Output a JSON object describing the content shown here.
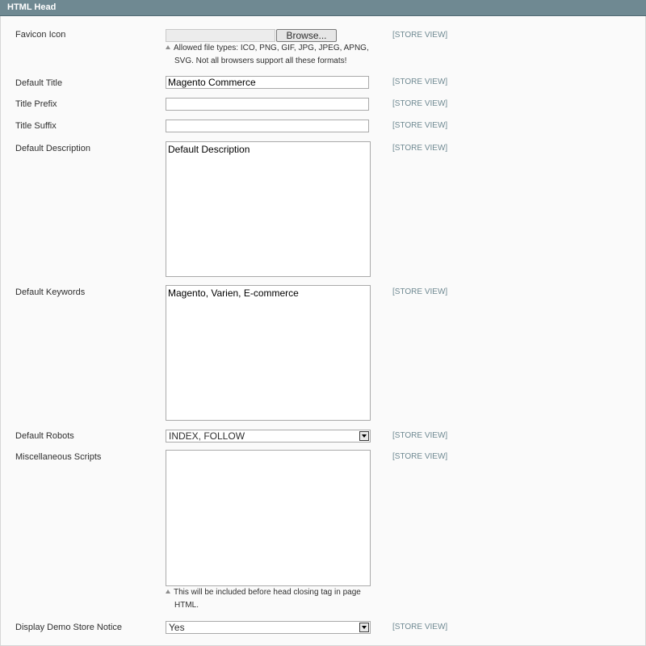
{
  "section": {
    "title": "HTML Head"
  },
  "scope_label": "[STORE VIEW]",
  "favicon": {
    "label": "Favicon Icon",
    "browse_label": "Browse...",
    "note": "Allowed file types: ICO, PNG, GIF, JPG, JPEG, APNG, SVG. Not all browsers support all these formats!"
  },
  "default_title": {
    "label": "Default Title",
    "value": "Magento Commerce"
  },
  "title_prefix": {
    "label": "Title Prefix",
    "value": ""
  },
  "title_suffix": {
    "label": "Title Suffix",
    "value": ""
  },
  "default_description": {
    "label": "Default Description",
    "value": "Default Description"
  },
  "default_keywords": {
    "label": "Default Keywords",
    "value": "Magento, Varien, E-commerce"
  },
  "default_robots": {
    "label": "Default Robots",
    "value": "INDEX, FOLLOW"
  },
  "misc_scripts": {
    "label": "Miscellaneous Scripts",
    "value": "",
    "note": "This will be included before head closing tag in page HTML."
  },
  "demo_notice": {
    "label": "Display Demo Store Notice",
    "value": "Yes"
  }
}
